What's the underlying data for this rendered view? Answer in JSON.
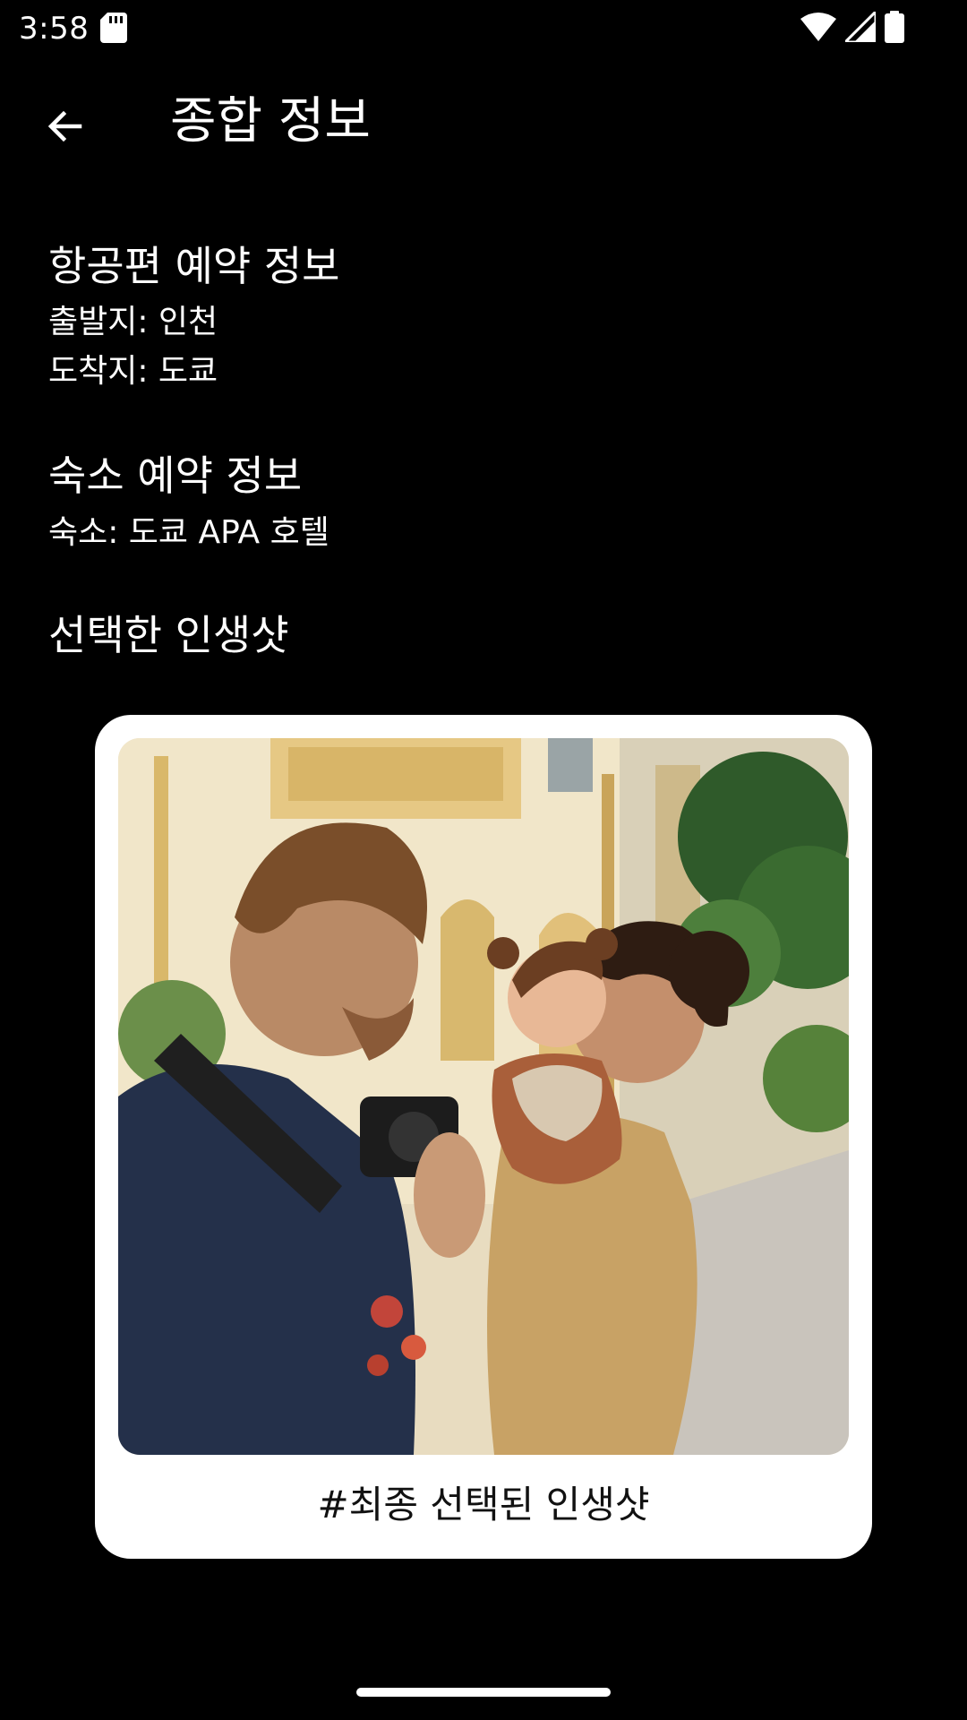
{
  "status_bar": {
    "time": "3:58",
    "icons": [
      "sd-card-icon",
      "wifi-icon",
      "cellular-signal-icon",
      "battery-icon"
    ]
  },
  "app_bar": {
    "title": "종합 정보",
    "back_icon": "arrow-back-icon"
  },
  "flight": {
    "title": "항공편 예약 정보",
    "departure": "출발지: 인천",
    "arrival": "도착지: 도쿄"
  },
  "accommodation": {
    "title": "숙소 예약 정보",
    "hotel": "숙소: 도쿄 APA 호텔"
  },
  "photo_section": {
    "title": "선택한 인생샷",
    "caption": "#최종 선택된 인생샷"
  },
  "colors": {
    "background": "#000000",
    "text": "#ffffff",
    "card": "#ffffff",
    "caption_text": "#111111"
  }
}
